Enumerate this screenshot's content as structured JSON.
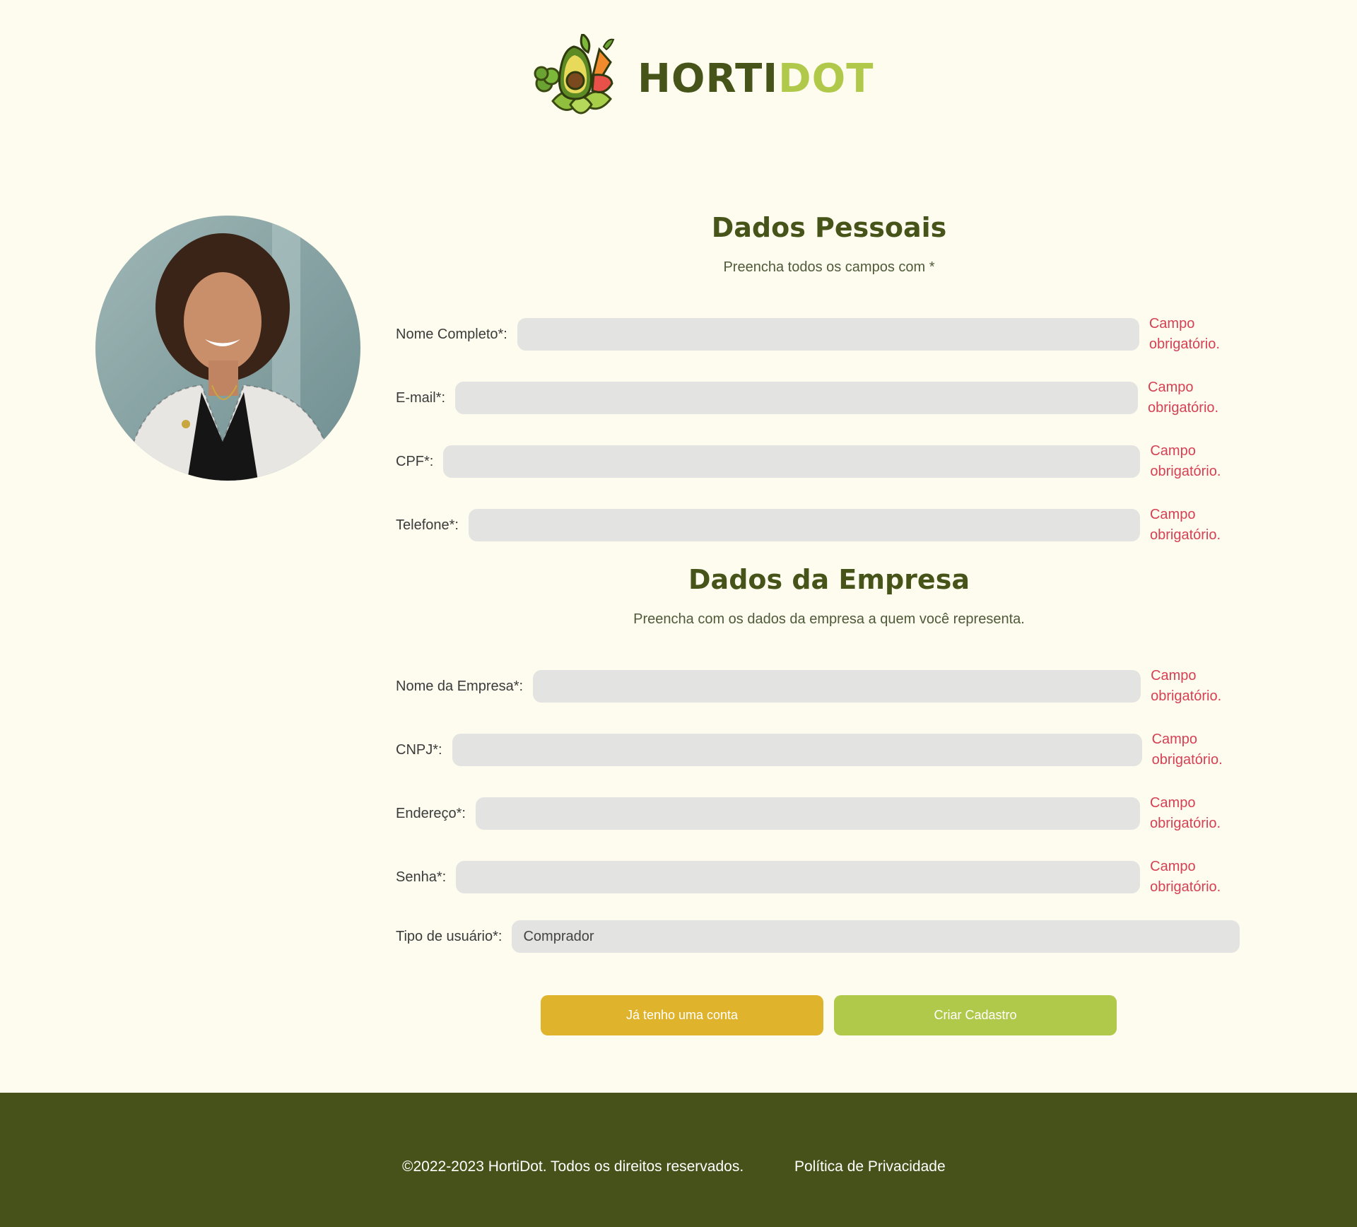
{
  "brand": {
    "name_part1": "HORTI",
    "name_part2": "DOT",
    "logo_icon": "vegetables-logo-icon",
    "colors": {
      "dark_green": "#46541a",
      "lime": "#b1c94a",
      "mustard": "#dfb32c",
      "error": "#d64054",
      "background": "#fefcee"
    }
  },
  "personal": {
    "title": "Dados Pessoais",
    "subtitle": "Preencha todos os campos com *",
    "fields": [
      {
        "label": "Nome Completo*:",
        "value": "",
        "error": "Campo obrigatório."
      },
      {
        "label": "E-mail*:",
        "value": "",
        "error": "Campo obrigatório."
      },
      {
        "label": "CPF*:",
        "value": "",
        "error": "Campo obrigatório."
      },
      {
        "label": "Telefone*:",
        "value": "",
        "error": "Campo obrigatório."
      }
    ]
  },
  "company": {
    "title": "Dados da Empresa",
    "subtitle": "Preencha com os dados da empresa a quem você representa.",
    "fields": [
      {
        "label": "Nome da Empresa*:",
        "value": "",
        "error": "Campo obrigatório."
      },
      {
        "label": "CNPJ*:",
        "value": "",
        "error": "Campo obrigatório."
      },
      {
        "label": "Endereço*:",
        "value": "",
        "error": "Campo obrigatório."
      },
      {
        "label": "Senha*:",
        "value": "",
        "error": "Campo obrigatório."
      }
    ],
    "user_type": {
      "label": "Tipo de usuário*:",
      "selected": "Comprador"
    }
  },
  "buttons": {
    "login": "Já tenho uma conta",
    "signup": "Criar Cadastro"
  },
  "footer": {
    "copyright": "©2022-2023 HortiDot. Todos os direitos reservados.",
    "privacy": "Política de Privacidade"
  }
}
